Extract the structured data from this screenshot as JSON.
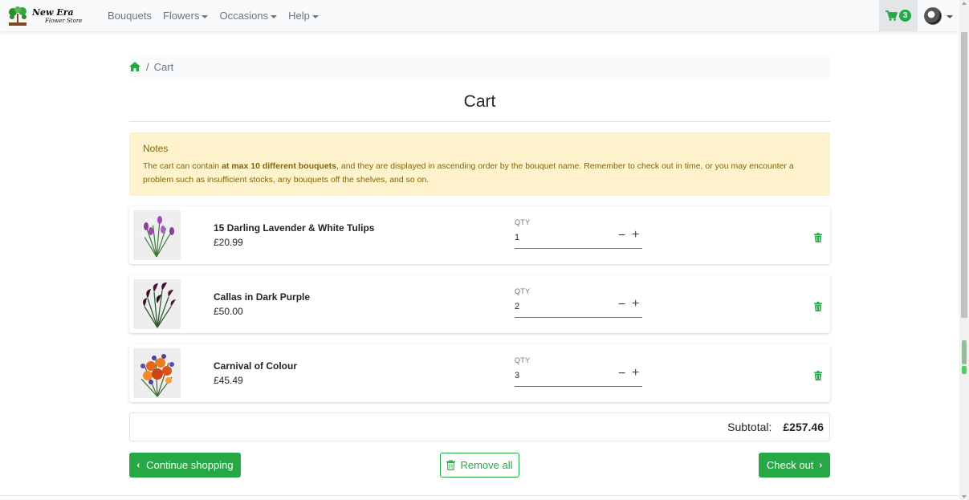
{
  "nav": {
    "brand_name": "New Era",
    "brand_sub": "Flower Store",
    "links": [
      "Bouquets",
      "Flowers",
      "Occasions",
      "Help"
    ],
    "cart_count": "3",
    "cart_icon": "shopping-cart-icon",
    "avatar_icon": "user-avatar"
  },
  "breadcrumb": {
    "home_icon": "home-icon",
    "current": "Cart",
    "separator": "/"
  },
  "page_title": "Cart",
  "notes": {
    "title": "Notes",
    "text_before": "The cart can contain ",
    "text_bold": "at max 10 different bouquets",
    "text_after": ", and they are displayed in ascending order by the bouquet name. Remember to check out in time, or you may encounter a problem such as insufficient stocks, any bouquets off the shelves, and so on."
  },
  "items": [
    {
      "name": "15 Darling Lavender & White Tulips",
      "price": "£20.99",
      "qty_label": "QTY",
      "qty": "1",
      "minus": "−",
      "plus": "+"
    },
    {
      "name": "Callas in Dark Purple",
      "price": "£50.00",
      "qty_label": "QTY",
      "qty": "2",
      "minus": "−",
      "plus": "+"
    },
    {
      "name": "Carnival of Colour",
      "price": "£45.49",
      "qty_label": "QTY",
      "qty": "3",
      "minus": "−",
      "plus": "+"
    }
  ],
  "subtotal": {
    "label": "Subtotal:",
    "value": "£257.46"
  },
  "actions": {
    "continue": "Continue shopping",
    "remove_all": "Remove all",
    "checkout": "Check out"
  },
  "colors": {
    "accent": "#28a745",
    "notes_bg": "#fff3cd",
    "notes_text": "#856404"
  }
}
